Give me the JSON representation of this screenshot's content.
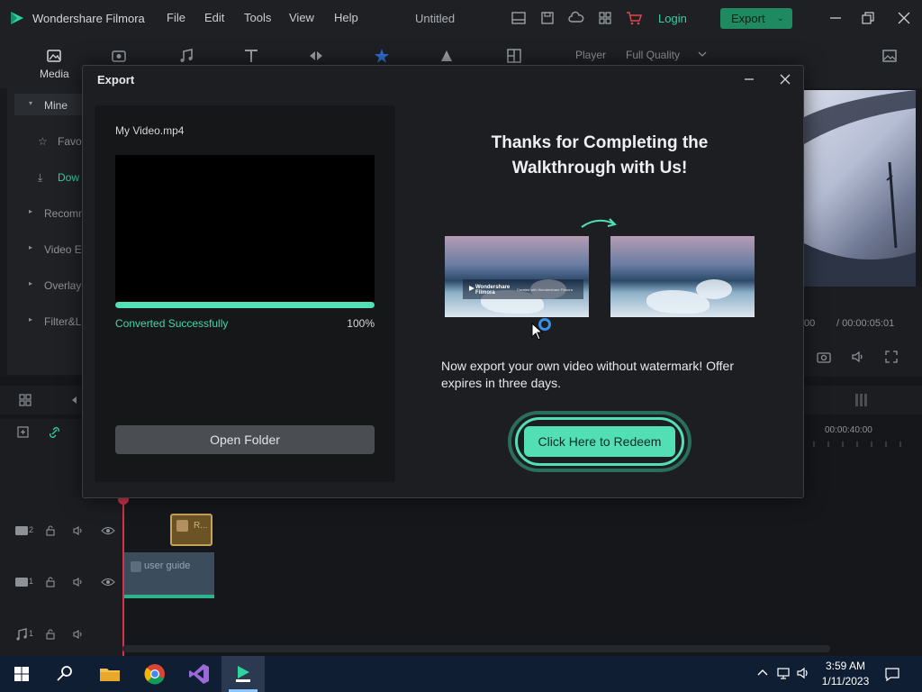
{
  "app": {
    "name": "Wondershare Filmora",
    "document_title": "Untitled",
    "menus": [
      "File",
      "Edit",
      "Tools",
      "View",
      "Help"
    ],
    "login_label": "Login",
    "export_label": "Export",
    "accent": "#2fd39d"
  },
  "toolbar": {
    "media_label": "Media",
    "player_label": "Player",
    "quality_label": "Full Quality"
  },
  "library": {
    "items": [
      "Mine",
      "Favo",
      "Dow",
      "Recomm",
      "Video E",
      "Overlay",
      "Filter&L"
    ]
  },
  "preview": {
    "time_current": "00",
    "time_total": "/  00:00:05:01"
  },
  "timeline": {
    "ruler_time": "00:00:40:00",
    "track_labels": [
      "2",
      "1",
      "1"
    ],
    "title_clip_label": "R...",
    "video_clip_label": "user guide"
  },
  "export_dialog": {
    "title": "Export",
    "file_name": "My Video.mp4",
    "progress_percent": 100,
    "status_text": "Converted Successfully",
    "percent_text": "100%",
    "open_folder_label": "Open Folder",
    "thanks_line1": "Thanks for Completing the",
    "thanks_line2": "Walkthrough with Us!",
    "watermark_brand": "Wondershare",
    "watermark_product": "Filmora",
    "watermark_caption": "Created with Wondershare Filmora",
    "offer_text": "Now export your own video without watermark! Offer expires in three days.",
    "redeem_label": "Click Here to Redeem",
    "button_color": "#53dfb4"
  },
  "taskbar": {
    "time": "3:59 AM",
    "date": "1/11/2023"
  }
}
